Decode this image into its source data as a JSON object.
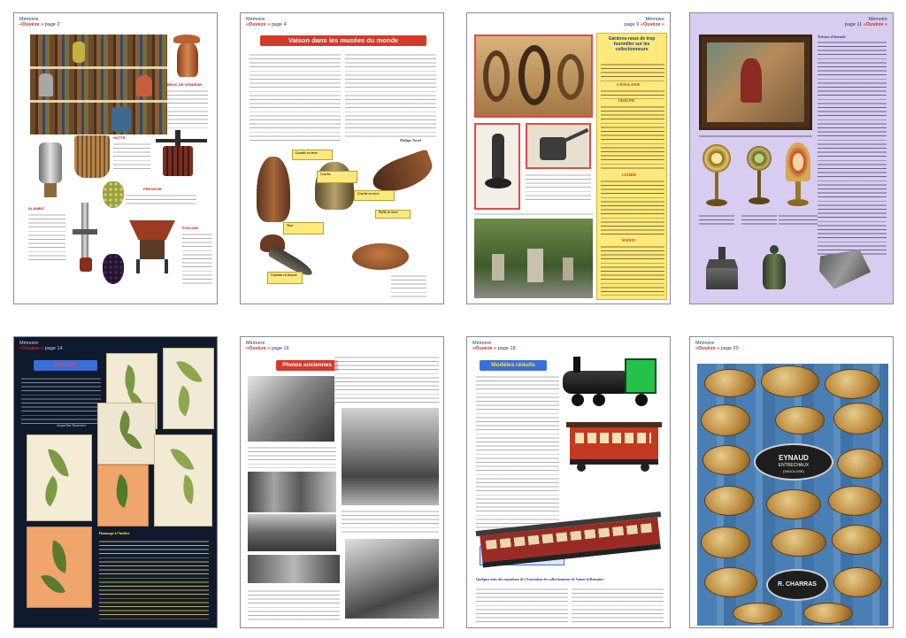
{
  "colors": {
    "red_banner": "#d33a2a",
    "blue_banner": "#3a6fd8",
    "accent_red": "#c2311f",
    "navy": "#1d3b78",
    "yellow_box": "#ffe97a",
    "lavender": "#d8cdf0",
    "dark_page": "#101a2c",
    "wood_blue": "#4a7fb5"
  },
  "pages": {
    "p1": {
      "header_top": "Mémoire",
      "header_brand": "«Ouvèze »",
      "header_num": "page 2",
      "cap1": "BROC DE VENDEUR",
      "cap2": "HOTTE",
      "cap3": "ALAMBIC",
      "cap4": "PRESSOIR",
      "cap5": "FOULOIR"
    },
    "p2": {
      "header_top": "Mémoire",
      "header_brand": "«Ouvèze »",
      "header_num": "page 4",
      "banner": "Vaison dans les musées du monde",
      "lbl1": "Gourde en terre",
      "lbl2": "Cruche",
      "lbl3": "Cruche en terre",
      "lbl4": "Vase",
      "lbl5": "Poêle en terre",
      "lbl6": "Couteau en bronze",
      "signature": "Philippe Turrel"
    },
    "p3": {
      "header_top": "Mémoire",
      "header_brand": "«Ouvèze »",
      "header_num": "page 9",
      "box_title": "Gardons-nous de trop fourmiller sur les collectionneurs",
      "sub1": "CAVALE ANNE",
      "sub2": "GISELINE",
      "sub3": "CLÉMÉE",
      "sub4": "MANON"
    },
    "p4": {
      "header_top": "Mémoire",
      "header_brand": "«Ouvèze »",
      "header_num": "page 11",
      "heading": "Trésors d'éternité"
    },
    "p5": {
      "header_top": "Mémoire",
      "header_brand": "«Ouvèze »",
      "header_num": "page 14",
      "banner": "Herbier",
      "signature": "Jacqueline Tourniaire",
      "poem_title": "Hommage à l'herbier"
    },
    "p6": {
      "header_top": "Mémoire",
      "header_brand": "«Ouvèze »",
      "header_num": "page 16",
      "banner": "Photos anciennes"
    },
    "p7": {
      "header_top": "Mémoire",
      "header_brand": "«Ouvèze »",
      "header_num": "page 18",
      "banner": "Modèles réduits",
      "signature": "Claude Lemaire",
      "caption": "Les reproductions de petit train du Buis sont fait reproduire à la taille ou par lui-même.",
      "list_title": "Quelques-unes des expositions de l'Association des collectionneurs de Vaison-la-Romaine :"
    },
    "p8": {
      "header_top": "Mémoire",
      "header_brand": "«Ouvèze »",
      "header_num": "page 20",
      "plate1": "EYNAUD",
      "plate1_sub": "ENTRECHAUX",
      "plate1_sub2": "(VAUCLUSE)",
      "plate2": "R. CHARRAS"
    }
  }
}
